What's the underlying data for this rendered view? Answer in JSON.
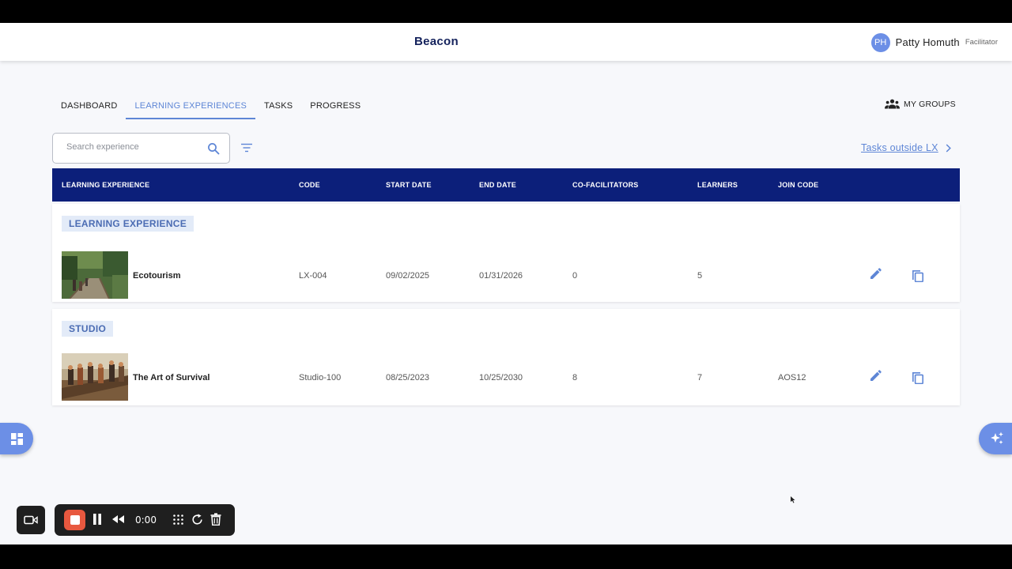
{
  "header": {
    "app_title": "Beacon",
    "user_initials": "PH",
    "user_name": "Patty Homuth",
    "user_role": "Facilitator"
  },
  "nav": {
    "tabs": [
      {
        "label": "DASHBOARD",
        "active": false
      },
      {
        "label": "LEARNING EXPERIENCES",
        "active": true
      },
      {
        "label": "TASKS",
        "active": false
      },
      {
        "label": "PROGRESS",
        "active": false
      }
    ],
    "my_groups_label": "MY GROUPS"
  },
  "search": {
    "placeholder": "Search experience",
    "value": ""
  },
  "tasks_outside_label": "Tasks outside LX",
  "table": {
    "columns": [
      "LEARNING EXPERIENCE",
      "CODE",
      "START DATE",
      "END DATE",
      "CO-FACILITATORS",
      "LEARNERS",
      "JOIN CODE"
    ],
    "groups": [
      {
        "label": "LEARNING EXPERIENCE",
        "rows": [
          {
            "name": "Ecotourism",
            "code": "LX-004",
            "start_date": "09/02/2025",
            "end_date": "01/31/2026",
            "co_facilitators": "0",
            "learners": "5",
            "join_code": ""
          }
        ]
      },
      {
        "label": "STUDIO",
        "rows": [
          {
            "name": "The Art of Survival",
            "code": "Studio-100",
            "start_date": "08/25/2023",
            "end_date": "10/25/2030",
            "co_facilitators": "8",
            "learners": "7",
            "join_code": "AOS12"
          }
        ]
      }
    ]
  },
  "recorder": {
    "time": "0:00"
  },
  "icons": {
    "search": "search-icon",
    "filter": "filter-icon",
    "groups": "group-icon",
    "chevron": "chevron-right-icon",
    "edit": "pencil-icon",
    "copy": "copy-icon",
    "apps": "grid-icon",
    "ai": "sparkle-icon"
  },
  "colors": {
    "accent": "#5e86d6",
    "table_header": "#0c1f7a",
    "brand_text": "#14225c",
    "record": "#e8583f"
  }
}
